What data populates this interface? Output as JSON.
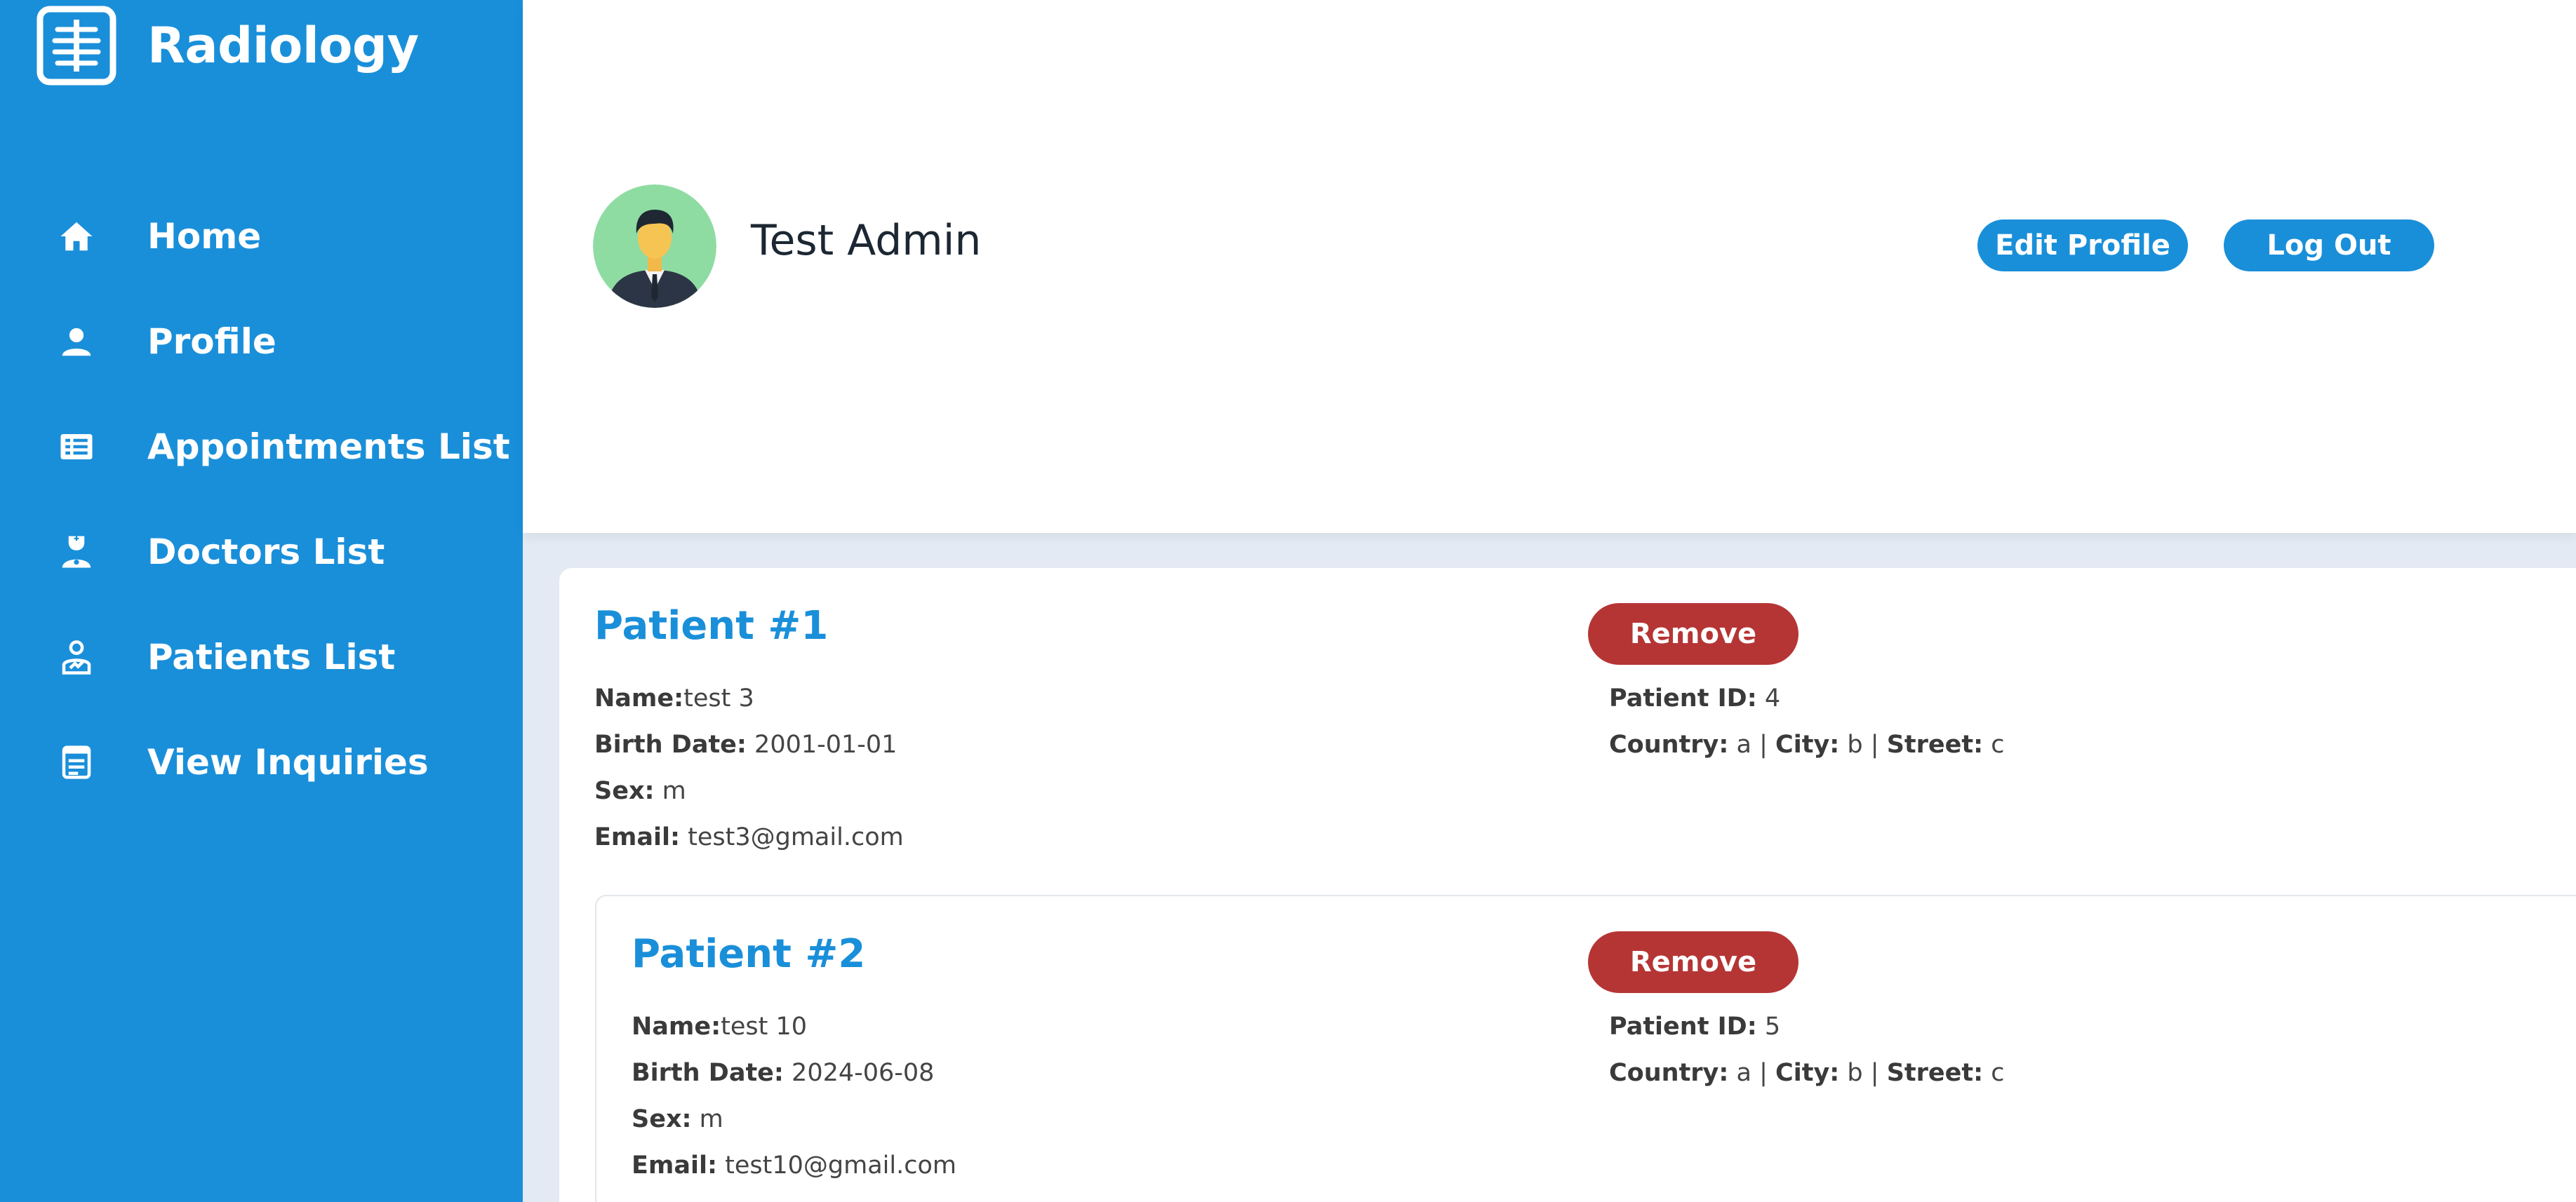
{
  "app": {
    "brand": "Radiology"
  },
  "sidebar": {
    "items": [
      {
        "label": "Home",
        "icon": "home-icon"
      },
      {
        "label": "Profile",
        "icon": "user-icon"
      },
      {
        "label": "Appointments List",
        "icon": "list-icon"
      },
      {
        "label": "Doctors List",
        "icon": "doctor-icon"
      },
      {
        "label": "Patients List",
        "icon": "patient-icon"
      },
      {
        "label": "View Inquiries",
        "icon": "document-icon"
      }
    ]
  },
  "header": {
    "user_name": "Test Admin",
    "edit_label": "Edit Profile",
    "logout_label": "Log Out"
  },
  "patients": [
    {
      "title": "Patient #1",
      "name": "test 3",
      "birth_date": "2001-01-01",
      "sex": "m",
      "email": "test3@gmail.com",
      "patient_id": "4",
      "country": "a",
      "city": "b",
      "street": "c",
      "remove_label": "Remove"
    },
    {
      "title": "Patient #2",
      "name": "test 10",
      "birth_date": "2024-06-08",
      "sex": "m",
      "email": "test10@gmail.com",
      "patient_id": "5",
      "country": "a",
      "city": "b",
      "street": "c",
      "remove_label": "Remove"
    }
  ],
  "labels": {
    "name": "Name:",
    "birth_date": "Birth Date:",
    "sex": "Sex:",
    "email": "Email:",
    "patient_id": "Patient ID:",
    "country": "Country:",
    "city": "City:",
    "street": "Street:",
    "separator": "|"
  },
  "colors": {
    "primary": "#1a8fd9",
    "danger": "#b53535",
    "page_bg": "#e4eaf3"
  }
}
